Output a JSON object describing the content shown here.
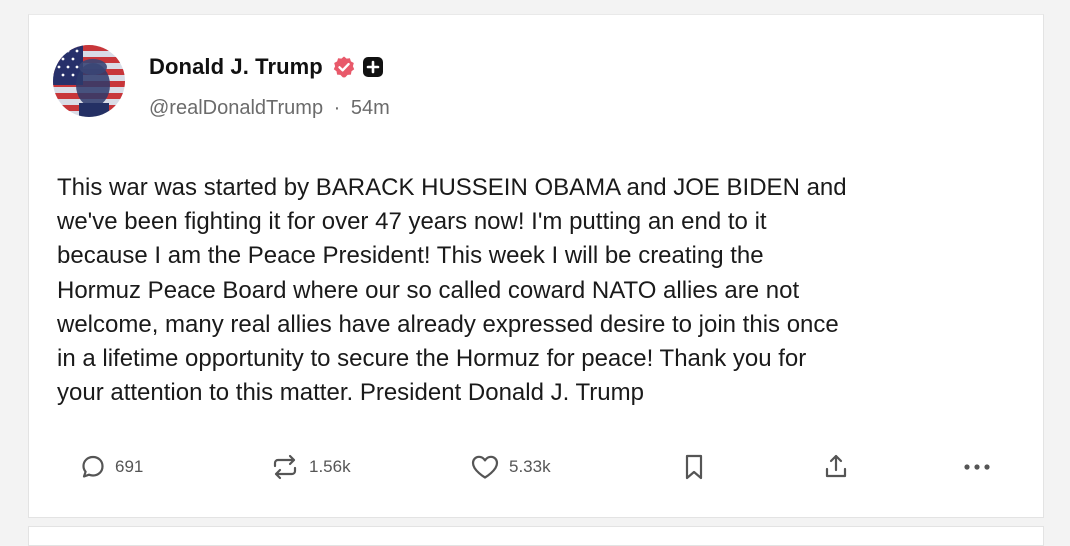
{
  "post": {
    "author": {
      "display_name": "Donald J. Trump",
      "handle": "@realDonaldTrump",
      "time_ago": "54m",
      "separator": "·",
      "verified_icon": "verified-badge-icon",
      "plus_icon": "plus-badge-icon",
      "avatar_icon": "flag-portrait-avatar"
    },
    "text": "This war was started by BARACK HUSSEIN OBAMA and JOE BIDEN and\nwe've been fighting it for over 47 years now! I'm putting an end to it\nbecause I am the Peace President! This week I will be creating the\nHormuz Peace Board where our so called coward NATO allies are not\nwelcome, many real allies have already expressed desire to join this once\nin a lifetime opportunity to secure the Hormuz for peace! Thank you for\nyour attention to this matter. President Donald J. Trump",
    "actions": {
      "replies": "691",
      "reposts": "1.56k",
      "likes": "5.33k"
    }
  },
  "colors": {
    "verified_badge": "#e8596a",
    "text": "#1a1a1a",
    "muted": "#6b6b6b"
  }
}
